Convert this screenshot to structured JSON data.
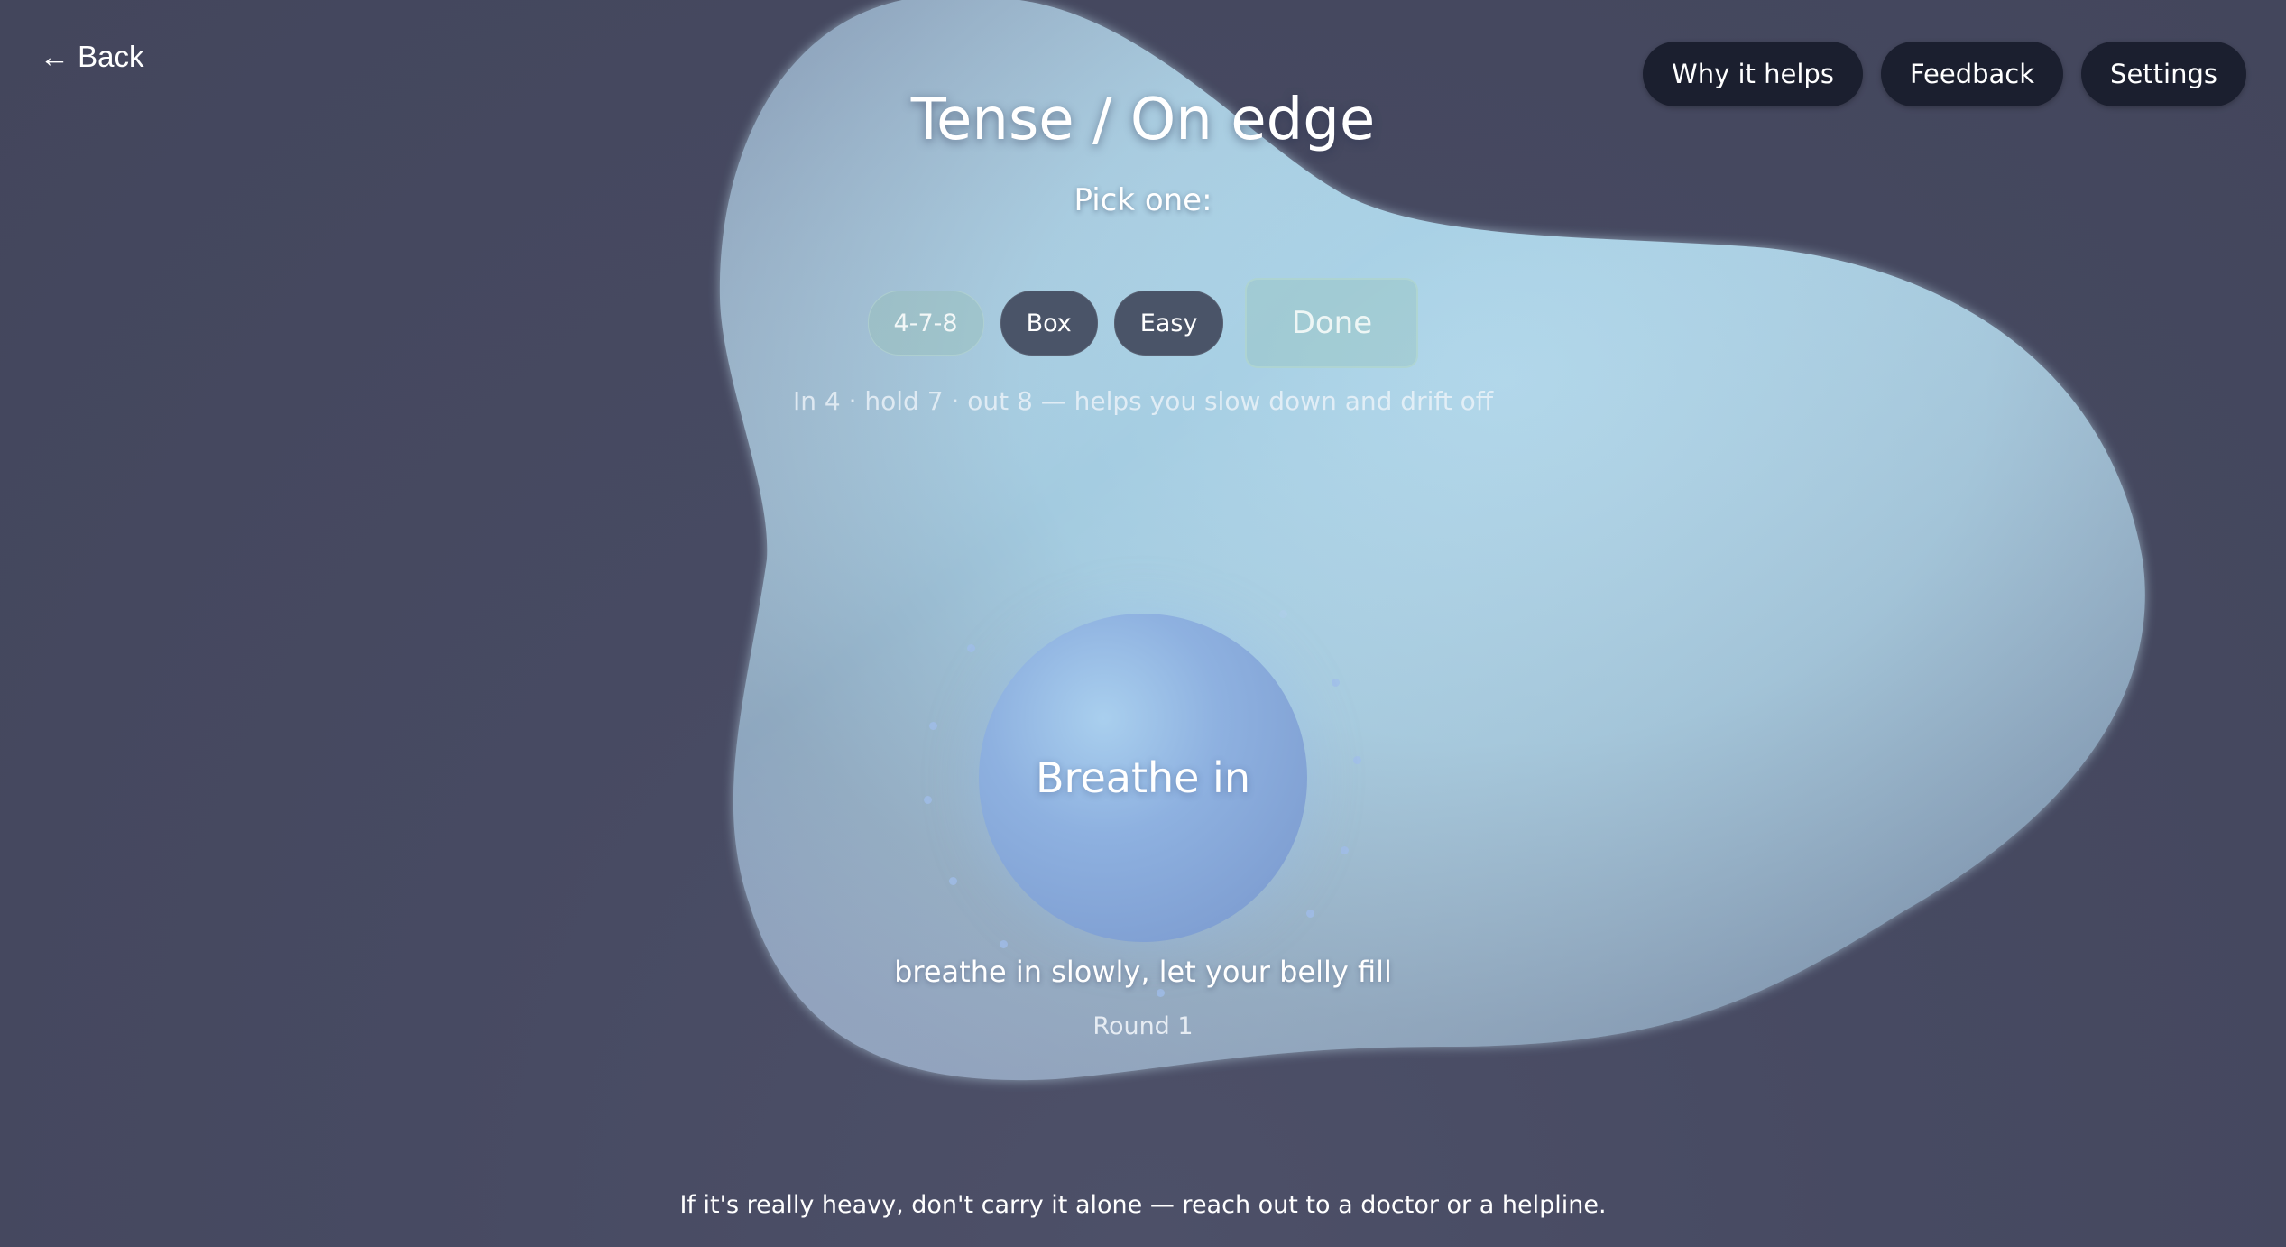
{
  "header": {
    "back_label": "← Back",
    "nav": [
      {
        "label": "Why it helps"
      },
      {
        "label": "Feedback"
      },
      {
        "label": "Settings"
      }
    ]
  },
  "main": {
    "title": "Tense / On edge",
    "subtitle": "Pick one:",
    "patterns": [
      {
        "label": "4-7-8",
        "selected": true
      },
      {
        "label": "Box",
        "selected": false
      },
      {
        "label": "Easy",
        "selected": false
      }
    ],
    "done_label": "Done",
    "pattern_description": "In 4 · hold 7 · out 8 — helps you slow down and drift off",
    "breath_phase": "Breathe in",
    "instruction": "breathe in slowly, let your belly fill",
    "round_label": "Round 1"
  },
  "footer": {
    "note": "If it's really heavy, don't carry it alone — reach out to a doctor or a helpline."
  },
  "colors": {
    "background": "#474a62",
    "blob": "#a9d3e8",
    "nav_button": "#1b1f2f",
    "breath_circle": "#8eb1e0",
    "selected_pill": "#96beb9"
  }
}
